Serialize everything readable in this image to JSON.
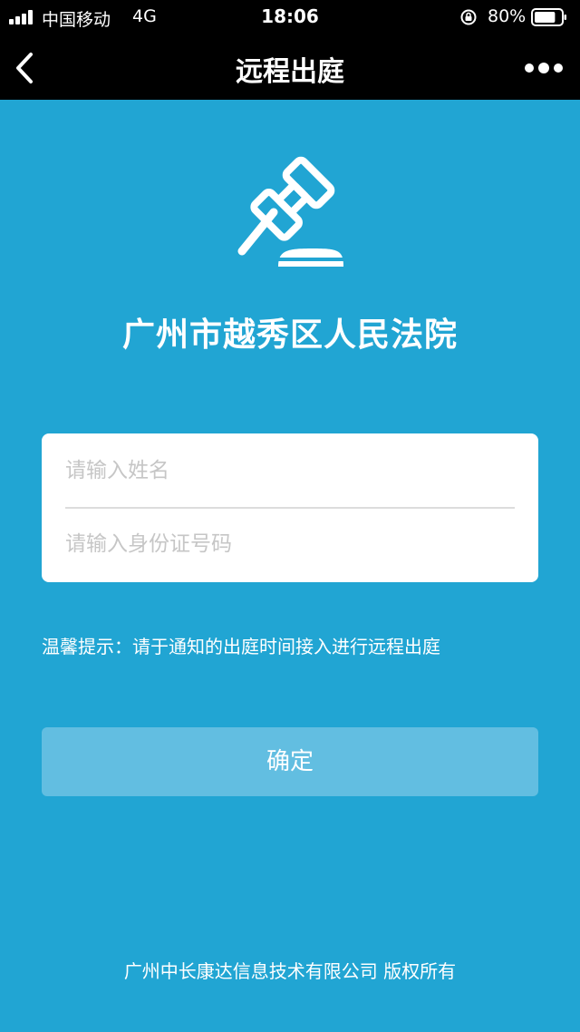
{
  "status_bar": {
    "carrier": "中国移动",
    "network": "4G",
    "time": "18:06",
    "battery_percent": "80%",
    "battery_level": 0.8
  },
  "nav": {
    "title": "远程出庭",
    "back_icon": "chevron-left-icon",
    "more_icon": "more-dots-icon"
  },
  "logo": {
    "icon": "gavel-icon"
  },
  "court_name": "广州市越秀区人民法院",
  "form": {
    "name_placeholder": "请输入姓名",
    "id_placeholder": "请输入身份证号码",
    "name_value": "",
    "id_value": ""
  },
  "tip": "温馨提示：请于通知的出庭时间接入进行远程出庭",
  "confirm_label": "确定",
  "copyright": "广州中长康达信息技术有限公司 版权所有",
  "colors": {
    "background": "#21a5d3",
    "button": "#62bee1",
    "bar": "#000000"
  }
}
